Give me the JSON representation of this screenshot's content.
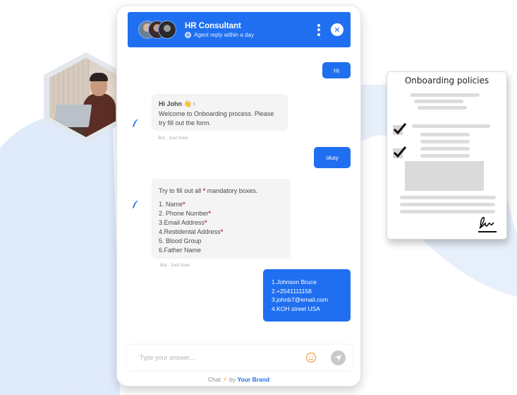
{
  "chat": {
    "header": {
      "title": "HR Consultant",
      "status": "Agent reply within a day",
      "accent": "#1f6ff0",
      "icons": {
        "menu": "kebab-menu-icon",
        "close": "close-icon",
        "status": "status-dot-icon"
      }
    },
    "messages": [
      {
        "sender": "user",
        "text": "Hi"
      },
      {
        "sender": "bot",
        "greeting": "Hi John",
        "emoji": "👋",
        "exclaim": "!",
        "lines": [
          "Welcome to Onboarding process. Please",
          "try fill out the form."
        ],
        "meta": "Bot . Just Now"
      },
      {
        "sender": "user",
        "text": "okay"
      },
      {
        "sender": "bot",
        "intro_pre": "Try to fill out all ",
        "required_mark": "*",
        "intro_post": " mandatory boxes.",
        "items": [
          {
            "text": "1. Name",
            "required": "*"
          },
          {
            "text": "2. Phone Number",
            "required": "*"
          },
          {
            "text": "3.Email Address",
            "required": "*"
          },
          {
            "text": "4.Restidental Address",
            "required": "*"
          },
          {
            "text": "5. Blood Group",
            "required": ""
          },
          {
            "text": "6.Father Name",
            "required": ""
          }
        ],
        "meta": "Bot . Just Now"
      },
      {
        "sender": "user",
        "lines": [
          "1.Johnson Bruce",
          "2.+2541111158",
          "3.johnb7@email.com",
          "4.KOH street USA"
        ]
      }
    ],
    "input": {
      "placeholder": "Type your answer...",
      "value": ""
    },
    "footer": {
      "prefix": "Chat",
      "bolt": "⚡",
      "by": "by",
      "brand": "Your Brand"
    }
  },
  "policy_card": {
    "title": "Onboarding policies",
    "checked_items": 2
  }
}
